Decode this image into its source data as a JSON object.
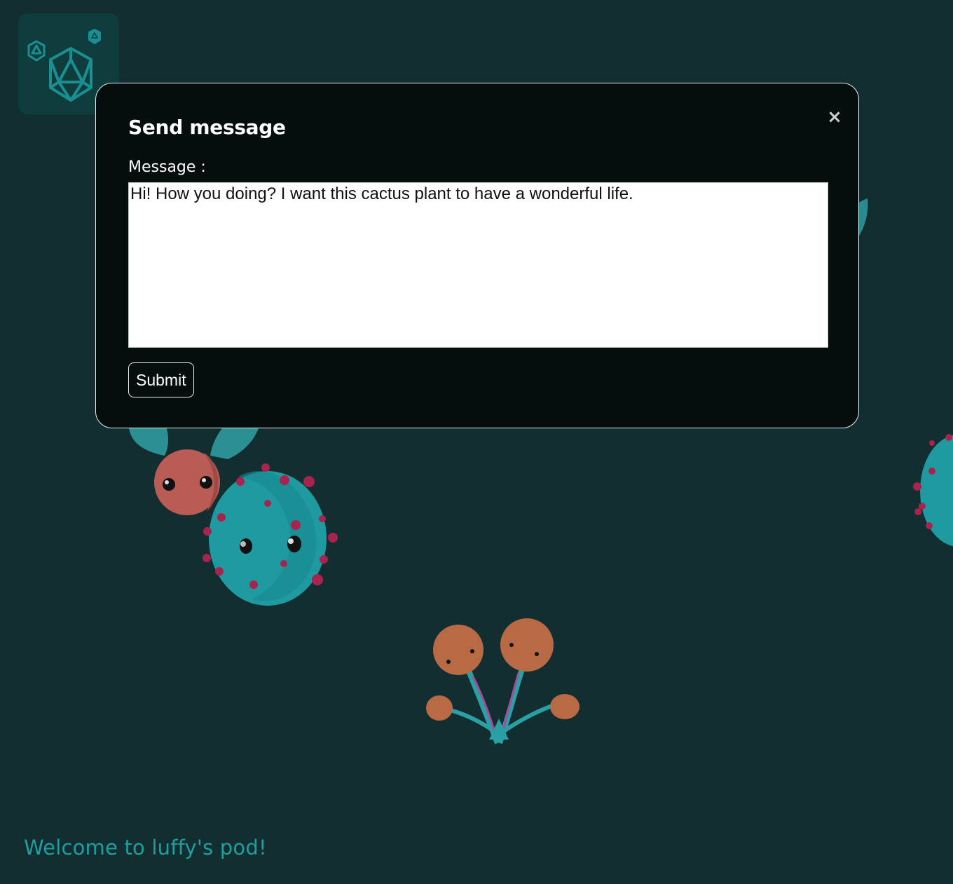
{
  "app": {
    "logo_icon": "polyhedron-dice-icon"
  },
  "modal": {
    "title": "Send message",
    "close_icon": "close-icon",
    "close_label": "×",
    "message_label": "Message :",
    "message_value": "Hi! How you doing? I want this cactus plant to have a wonderful life.",
    "submit_label": "Submit"
  },
  "footer": {
    "welcome_text": "Welcome to luffy's pod!"
  },
  "colors": {
    "background": "#132e30",
    "modal_background": "#050e0d",
    "accent": "#1f9ea0",
    "cactus": "#1f9aa0",
    "radish": "#b85c55",
    "mushroom": "#b86a45",
    "spikes": "#a8244e"
  }
}
